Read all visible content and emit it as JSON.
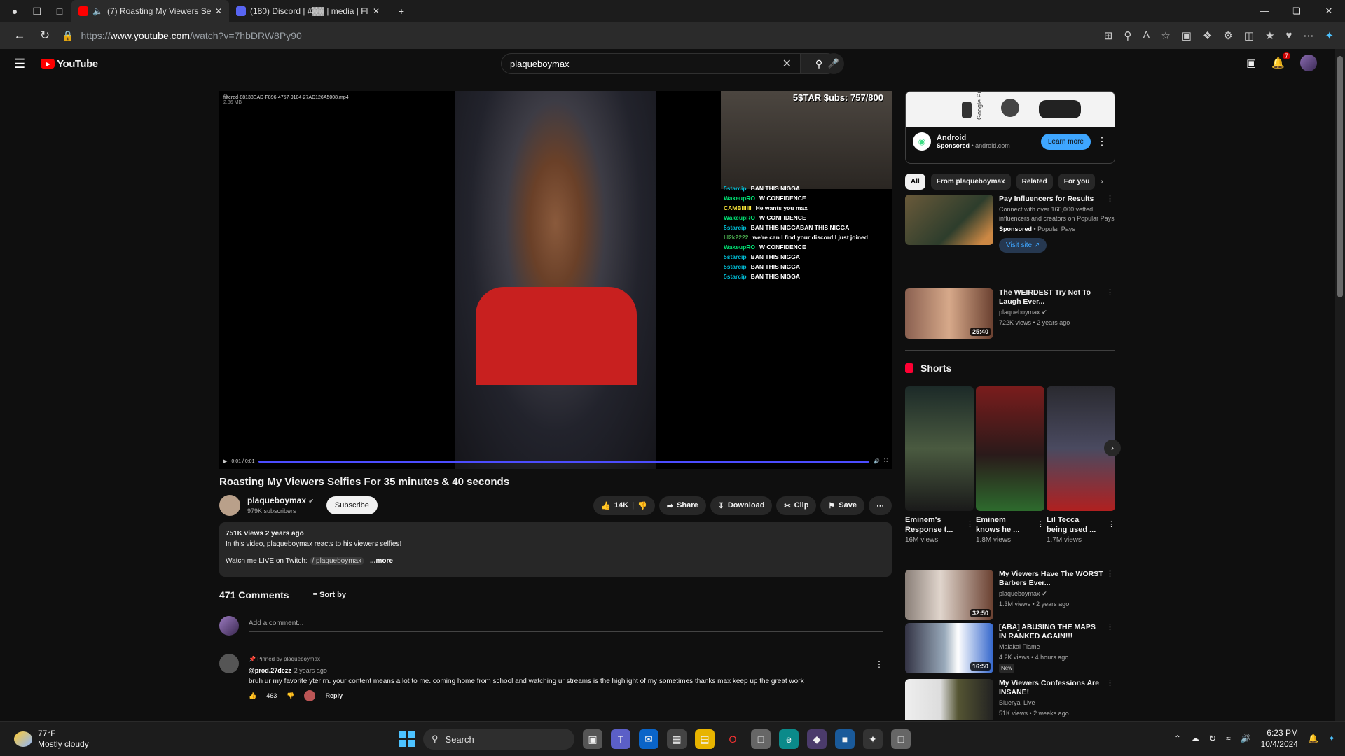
{
  "browser": {
    "tabs": [
      {
        "title": "(7) Roasting My Viewers Sel",
        "active": true
      },
      {
        "title": "(180) Discord | #▓▓ | media | Fla",
        "active": false
      }
    ],
    "new_tab": "+",
    "url_prefix": "https://",
    "url_domain": "www.youtube.com",
    "url_path": "/watch?v=7hbDRW8Py90"
  },
  "header": {
    "logo": "YouTube",
    "search_value": "plaqueboymax",
    "notification_count": "7"
  },
  "video": {
    "file_label": "filtered-88138EAD-F896-4757-9104-27AD126A5008.mp4",
    "file_size": "2.86 MB",
    "subs_overlay": "5$TAR $ubs: 757/800",
    "chat": [
      {
        "user": "5starcip",
        "msg": "BAN THIS NIGGA"
      },
      {
        "user": "WakeupRO",
        "msg": "W CONFIDENCE"
      },
      {
        "user": "CAMBIIIIII",
        "msg": "He wants you max"
      },
      {
        "user": "WakeupRO",
        "msg": "W CONFIDENCE"
      },
      {
        "user": "5starcip",
        "msg": "BAN THIS NIGGABAN THIS NIGGA"
      },
      {
        "user": "lil2k2222",
        "msg": "we're can I find your discord I just joined"
      },
      {
        "user": "WakeupRO",
        "msg": "W CONFIDENCE"
      },
      {
        "user": "5starcip",
        "msg": "BAN THIS NIGGA"
      },
      {
        "user": "5starcip",
        "msg": "BAN THIS NIGGA"
      },
      {
        "user": "5starcip",
        "msg": "BAN THIS NIGGA"
      }
    ],
    "time": "0:01 / 0:01",
    "title": "Roasting My Viewers Selfies For 35 minutes & 40 seconds"
  },
  "channel": {
    "name": "plaqueboymax",
    "subscribers": "979K subscribers",
    "subscribe": "Subscribe"
  },
  "actions": {
    "likes": "14K",
    "share": "Share",
    "download": "Download",
    "clip": "Clip",
    "save": "Save"
  },
  "description": {
    "meta": "751K views  2 years ago",
    "line1": "In this video, plaqueboymax reacts to his viewers selfies!",
    "line2": "Watch me LIVE on Twitch:",
    "twitch": "/ plaqueboymax",
    "more": "...more"
  },
  "comments": {
    "count": "471 Comments",
    "sort": "Sort by",
    "add_placeholder": "Add a comment...",
    "pinned": "Pinned by plaqueboymax",
    "user": "@prod.27dezz",
    "when": "2 years ago",
    "text": "bruh ur my favorite yter rn. your content means a lot to me. coming home from school and watching ur streams is the highlight of my sometimes thanks max keep up the great work",
    "likes": "463",
    "reply": "Reply"
  },
  "ad": {
    "brand_words": "Google  Pixel",
    "name": "Android",
    "sponsored": "Sponsored",
    "domain": "android.com",
    "cta": "Learn more"
  },
  "chips": [
    "All",
    "From plaqueboymax",
    "Related",
    "For you"
  ],
  "recommended": [
    {
      "title": "Pay Influencers for Results",
      "desc": "Connect with over 160,000 vetted influencers and creators on Popular Pays",
      "channel": "Popular Pays",
      "sponsored": "Sponsored",
      "cta": "Visit site"
    },
    {
      "title": "The WEIRDEST Try Not To Laugh Ever...",
      "channel": "plaqueboymax",
      "meta": "722K views • 2 years ago",
      "duration": "25:40"
    },
    {
      "title": "My Viewers Have The WORST Barbers Ever...",
      "channel": "plaqueboymax",
      "meta": "1.3M views • 2 years ago",
      "duration": "32:50"
    },
    {
      "title": "[ABA] ABUSING THE MAPS IN RANKED AGAIN!!!",
      "channel": "Malakai Flame",
      "meta": "4.2K views • 4 hours ago",
      "duration": "16:50",
      "badge": "New"
    },
    {
      "title": "My Viewers Confessions Are INSANE!",
      "channel": "Blueryai Live",
      "meta": "51K views • 2 weeks ago"
    }
  ],
  "shorts": {
    "heading": "Shorts",
    "items": [
      {
        "title": "Eminem's\nResponse t...",
        "views": "16M views"
      },
      {
        "title": "Eminem\nknows he ...",
        "views": "1.8M views"
      },
      {
        "title": "Lil Tecca\nbeing used ...",
        "views": "1.7M views"
      }
    ]
  },
  "taskbar": {
    "temp": "77°F",
    "weather": "Mostly cloudy",
    "search": "Search",
    "time": "6:23 PM",
    "date": "10/4/2024"
  }
}
